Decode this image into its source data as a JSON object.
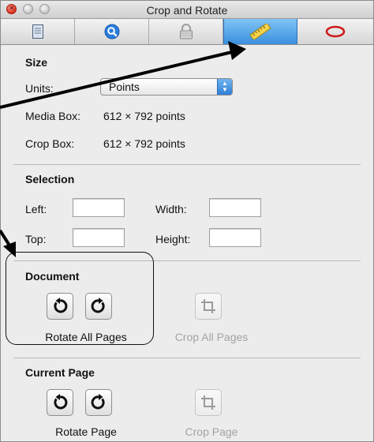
{
  "window": {
    "title": "Crop and Rotate"
  },
  "toolbar": {
    "tabs": [
      {
        "icon": "document-icon",
        "selected": false
      },
      {
        "icon": "magnifier-icon",
        "selected": false
      },
      {
        "icon": "lock-icon",
        "selected": false
      },
      {
        "icon": "ruler-icon",
        "selected": true
      },
      {
        "icon": "oval-icon",
        "selected": false
      }
    ]
  },
  "size": {
    "title": "Size",
    "units_label": "Units:",
    "units_value": "Points",
    "media_box_label": "Media Box:",
    "media_box_value": "612 × 792 points",
    "crop_box_label": "Crop Box:",
    "crop_box_value": "612 × 792 points"
  },
  "selection": {
    "title": "Selection",
    "left_label": "Left:",
    "width_label": "Width:",
    "top_label": "Top:",
    "height_label": "Height:",
    "left_value": "",
    "width_value": "",
    "top_value": "",
    "height_value": ""
  },
  "document": {
    "title": "Document",
    "rotate_label": "Rotate All Pages",
    "crop_label": "Crop All Pages"
  },
  "current_page": {
    "title": "Current Page",
    "rotate_label": "Rotate Page",
    "crop_label": "Crop Page"
  },
  "colors": {
    "selected_tab": "#3b8fde",
    "close_button": "#d8281b",
    "oval_icon": "#d01818",
    "disabled_text": "#a3a3a3"
  }
}
